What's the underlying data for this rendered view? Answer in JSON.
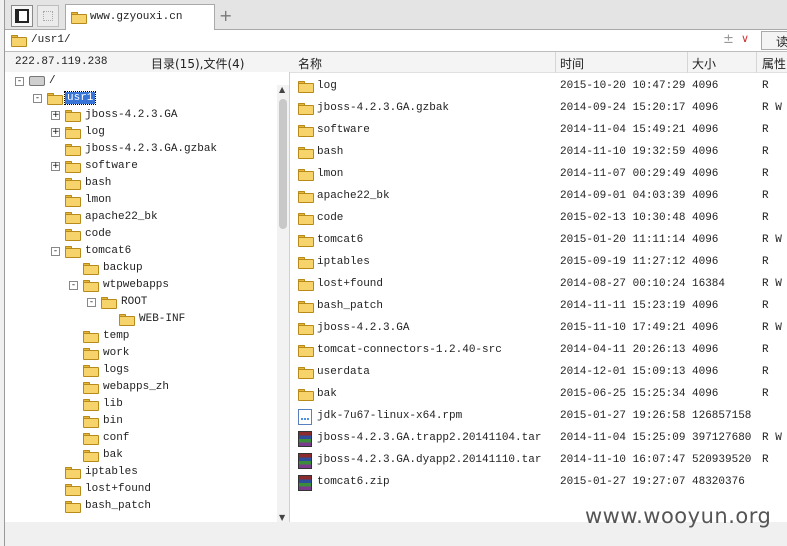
{
  "tabbar": {
    "tab_label": "www.gzyouxi.cn",
    "new_tab": "+"
  },
  "address": {
    "path": "/usr1/",
    "pm": "±",
    "dropdown": "∨",
    "read_label": "读"
  },
  "left": {
    "ip": "222.87.119.238",
    "count": "目录(15),文件(4)",
    "tree": [
      {
        "label": "/",
        "exp": "-",
        "kind": "drive"
      },
      {
        "label": "usr1",
        "exp": "-",
        "kind": "folder",
        "selected": true
      },
      {
        "label": "jboss-4.2.3.GA",
        "exp": "+",
        "kind": "folder"
      },
      {
        "label": "log",
        "exp": "+",
        "kind": "folder"
      },
      {
        "label": "jboss-4.2.3.GA.gzbak",
        "exp": "",
        "kind": "folder"
      },
      {
        "label": "software",
        "exp": "+",
        "kind": "folder"
      },
      {
        "label": "bash",
        "exp": "",
        "kind": "folder"
      },
      {
        "label": "lmon",
        "exp": "",
        "kind": "folder"
      },
      {
        "label": "apache22_bk",
        "exp": "",
        "kind": "folder"
      },
      {
        "label": "code",
        "exp": "",
        "kind": "folder"
      },
      {
        "label": "tomcat6",
        "exp": "-",
        "kind": "folder"
      },
      {
        "label": "backup",
        "exp": "",
        "kind": "folder"
      },
      {
        "label": "wtpwebapps",
        "exp": "-",
        "kind": "folder"
      },
      {
        "label": "ROOT",
        "exp": "-",
        "kind": "folder"
      },
      {
        "label": "WEB-INF",
        "exp": "",
        "kind": "folder"
      },
      {
        "label": "temp",
        "exp": "",
        "kind": "folder"
      },
      {
        "label": "work",
        "exp": "",
        "kind": "folder"
      },
      {
        "label": "logs",
        "exp": "",
        "kind": "folder"
      },
      {
        "label": "webapps_zh",
        "exp": "",
        "kind": "folder"
      },
      {
        "label": "lib",
        "exp": "",
        "kind": "folder"
      },
      {
        "label": "bin",
        "exp": "",
        "kind": "folder"
      },
      {
        "label": "conf",
        "exp": "",
        "kind": "folder"
      },
      {
        "label": "bak",
        "exp": "",
        "kind": "folder"
      },
      {
        "label": "iptables",
        "exp": "",
        "kind": "folder"
      },
      {
        "label": "lost+found",
        "exp": "",
        "kind": "folder"
      },
      {
        "label": "bash_patch",
        "exp": "",
        "kind": "folder"
      }
    ]
  },
  "right": {
    "headers": {
      "name": "名称",
      "time": "时间",
      "size": "大小",
      "attr": "属性"
    },
    "files": [
      {
        "name": "log",
        "time": "2015-10-20 10:47:29",
        "size": "4096",
        "attr": "R",
        "type": "folder"
      },
      {
        "name": "jboss-4.2.3.GA.gzbak",
        "time": "2014-09-24 15:20:17",
        "size": "4096",
        "attr": "R W",
        "type": "folder"
      },
      {
        "name": "software",
        "time": "2014-11-04 15:49:21",
        "size": "4096",
        "attr": "R",
        "type": "folder"
      },
      {
        "name": "bash",
        "time": "2014-11-10 19:32:59",
        "size": "4096",
        "attr": "R",
        "type": "folder"
      },
      {
        "name": "lmon",
        "time": "2014-11-07 00:29:49",
        "size": "4096",
        "attr": "R",
        "type": "folder"
      },
      {
        "name": "apache22_bk",
        "time": "2014-09-01 04:03:39",
        "size": "4096",
        "attr": "R",
        "type": "folder"
      },
      {
        "name": "code",
        "time": "2015-02-13 10:30:48",
        "size": "4096",
        "attr": "R",
        "type": "folder"
      },
      {
        "name": "tomcat6",
        "time": "2015-01-20 11:11:14",
        "size": "4096",
        "attr": "R W",
        "type": "folder"
      },
      {
        "name": "iptables",
        "time": "2015-09-19 11:27:12",
        "size": "4096",
        "attr": "R",
        "type": "folder"
      },
      {
        "name": "lost+found",
        "time": "2014-08-27 00:10:24",
        "size": "16384",
        "attr": "R W",
        "type": "folder"
      },
      {
        "name": "bash_patch",
        "time": "2014-11-11 15:23:19",
        "size": "4096",
        "attr": "R",
        "type": "folder"
      },
      {
        "name": "jboss-4.2.3.GA",
        "time": "2015-11-10 17:49:21",
        "size": "4096",
        "attr": "R W",
        "type": "folder"
      },
      {
        "name": "tomcat-connectors-1.2.40-src",
        "time": "2014-04-11 20:26:13",
        "size": "4096",
        "attr": "R",
        "type": "folder"
      },
      {
        "name": "userdata",
        "time": "2014-12-01 15:09:13",
        "size": "4096",
        "attr": "R",
        "type": "folder"
      },
      {
        "name": "bak",
        "time": "2015-06-25 15:25:34",
        "size": "4096",
        "attr": "R",
        "type": "folder"
      },
      {
        "name": "jdk-7u67-linux-x64.rpm",
        "time": "2015-01-27 19:26:58",
        "size": "126857158",
        "attr": "",
        "type": "doc"
      },
      {
        "name": "jboss-4.2.3.GA.trapp2.20141104.tar",
        "time": "2014-11-04 15:25:09",
        "size": "397127680",
        "attr": "R W",
        "type": "rar"
      },
      {
        "name": "jboss-4.2.3.GA.dyapp2.20141110.tar",
        "time": "2014-11-10 16:07:47",
        "size": "520939520",
        "attr": "R",
        "type": "rar"
      },
      {
        "name": "tomcat6.zip",
        "time": "2015-01-27 19:27:07",
        "size": "48320376",
        "attr": "",
        "type": "rar"
      }
    ]
  },
  "watermark": "www.wooyun.org"
}
